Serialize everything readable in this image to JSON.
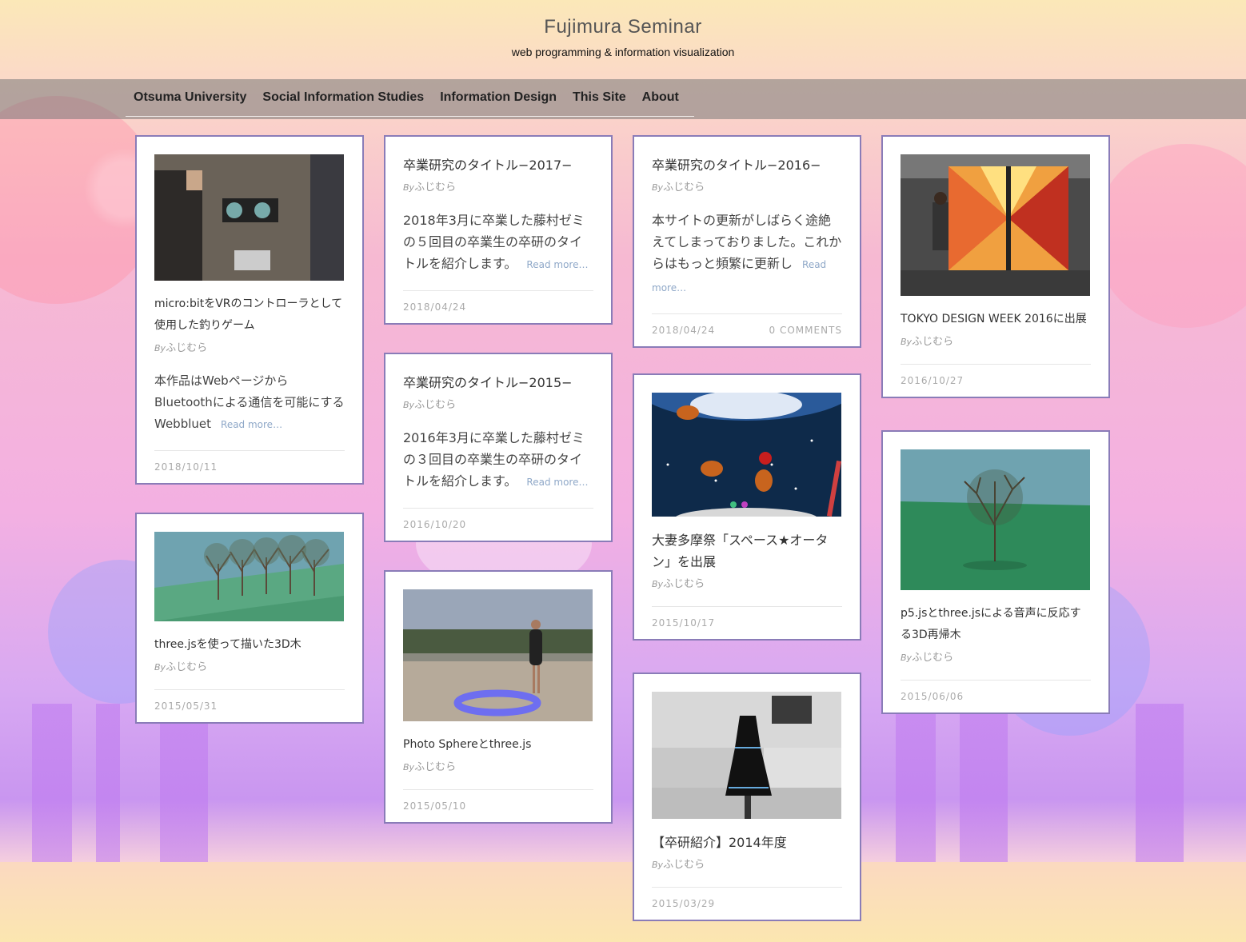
{
  "site": {
    "title": "Fujimura Seminar",
    "tagline": "web programming & information visualization"
  },
  "nav": [
    {
      "label": "Otsuma University"
    },
    {
      "label": "Social Information Studies"
    },
    {
      "label": "Information Design"
    },
    {
      "label": "This Site"
    },
    {
      "label": "About"
    }
  ],
  "posts": [
    {
      "title": "micro:bitをVRのコントローラとして使用した釣りゲーム",
      "by": "By",
      "author": "ふじむら",
      "excerpt": "本作品はWebページからBluetoothによる通信を可能にするWebbluet",
      "read_more": "Read more…",
      "date": "2018/10/11",
      "image": "photo-vr-controller"
    },
    {
      "title": "three.jsを使って描いた3D木",
      "by": "By",
      "author": "ふじむら",
      "date": "2015/05/31",
      "image": "render-3d-trees"
    },
    {
      "title": "卒業研究のタイトル−2017−",
      "by": "By",
      "author": "ふじむら",
      "excerpt": "2018年3月に卒業した藤村ゼミの５回目の卒業生の卒研のタイトルを紹介します。",
      "read_more": "Read more…",
      "date": "2018/04/24"
    },
    {
      "title": "卒業研究のタイトル−2015−",
      "by": "By",
      "author": "ふじむら",
      "excerpt": "2016年3月に卒業した藤村ゼミの３回目の卒業生の卒研のタイトルを紹介します。",
      "read_more": "Read more…",
      "date": "2016/10/20"
    },
    {
      "title": "Photo Sphereとthree.js",
      "by": "By",
      "author": "ふじむら",
      "date": "2015/05/10",
      "image": "render-photo-sphere"
    },
    {
      "title": "卒業研究のタイトル−2016−",
      "by": "By",
      "author": "ふじむら",
      "excerpt": "本サイトの更新がしばらく途絶えてしまっておりました。これからはもっと頻繁に更新し",
      "read_more": "Read more…",
      "date": "2018/04/24",
      "comments": "0 COMMENTS"
    },
    {
      "title": "大妻多摩祭「スペース★オータン」を出展",
      "by": "By",
      "author": "ふじむら",
      "date": "2015/10/17",
      "image": "render-space-game"
    },
    {
      "title": "【卒研紹介】2014年度",
      "by": "By",
      "author": "ふじむら",
      "date": "2015/03/29",
      "image": "photo-dress"
    },
    {
      "title": "TOKYO DESIGN WEEK 2016に出展",
      "by": "By",
      "author": "ふじむら",
      "date": "2016/10/27",
      "image": "photo-exhibition"
    },
    {
      "title": "p5.jsとthree.jsによる音声に反応する3D再帰木",
      "by": "By",
      "author": "ふじむら",
      "date": "2015/06/06",
      "image": "render-recursive-tree"
    }
  ]
}
